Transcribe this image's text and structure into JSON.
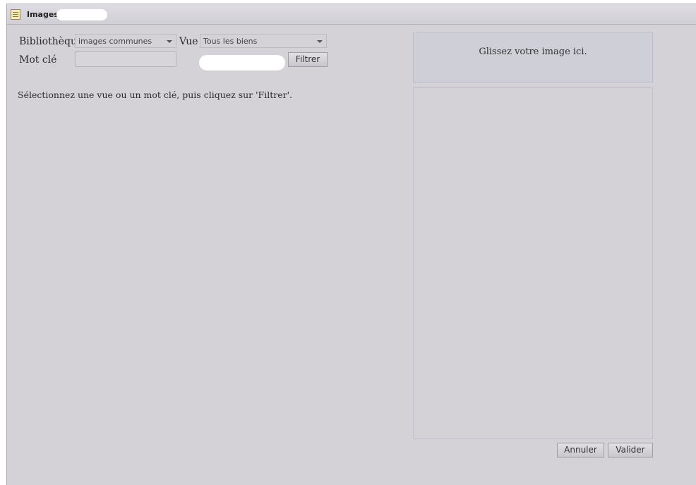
{
  "window": {
    "title": "Images"
  },
  "form": {
    "library_label": "Bibliothèque",
    "library_value": "images communes",
    "view_label": "Vue",
    "view_value": "Tous les biens",
    "keyword_label": "Mot clé",
    "keyword_value": "",
    "filter_button": "Filtrer"
  },
  "hint": "Sélectionnez une vue ou un mot clé, puis cliquez sur 'Filtrer'.",
  "dropzone": {
    "text": "Glissez votre image ici."
  },
  "actions": {
    "cancel": "Annuler",
    "validate": "Valider"
  },
  "icons": {
    "title_icon": "document-list-icon",
    "select_arrow": "chevron-down-icon"
  }
}
